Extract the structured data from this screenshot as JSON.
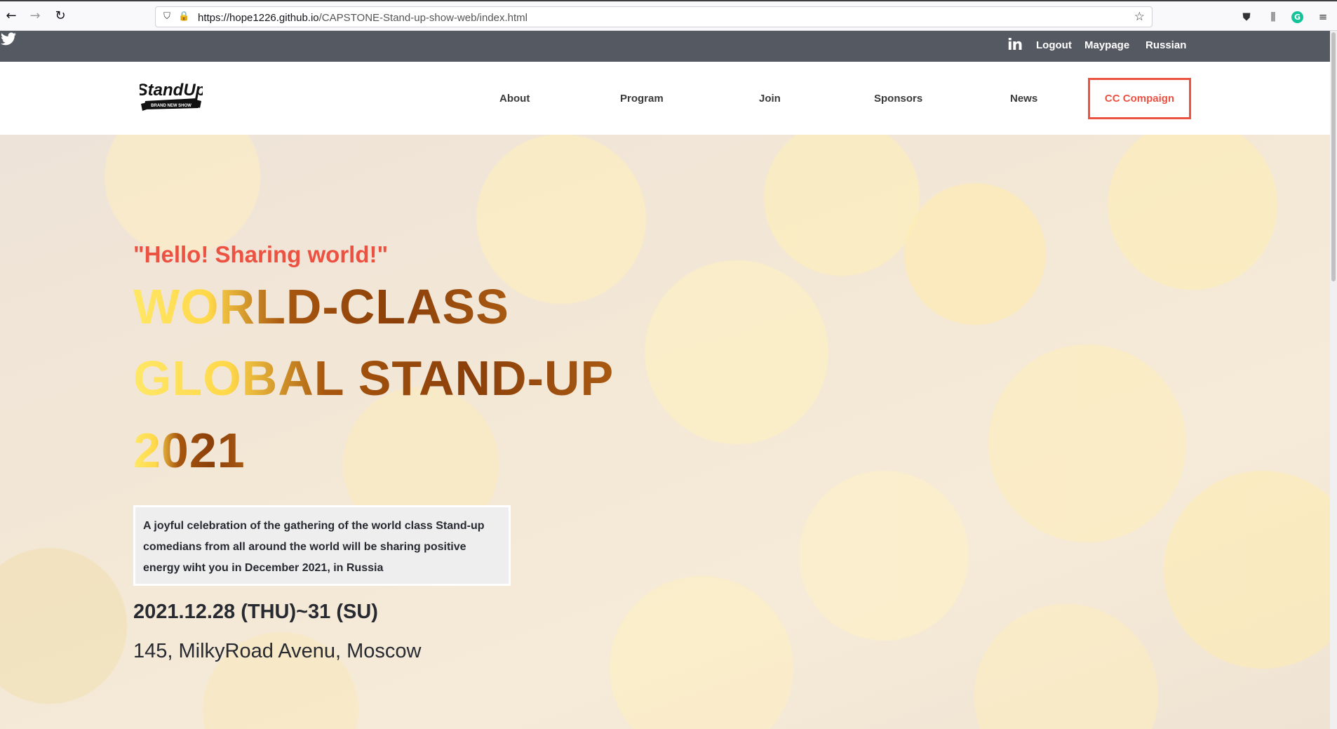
{
  "browser": {
    "url_host": "https://hope1226.github.io",
    "url_path": "/CAPSTONE-Stand-up-show-web/index.html"
  },
  "topbar": {
    "icons": [
      "twitter-icon",
      "linkedin-icon"
    ],
    "linkedin_glyph": "in",
    "links": [
      "Logout",
      "Maypage",
      "Russian"
    ]
  },
  "header": {
    "logo_text": "StandUp",
    "logo_subtext": "BRAND NEW SHOW",
    "menu": [
      "About",
      "Program",
      "Join",
      "Sponsors",
      "News"
    ],
    "cta": "CC Compaign",
    "accent_color": "#ec5242"
  },
  "hero": {
    "tagline": "\"Hello! Sharing world!\"",
    "headline_lines": [
      "WORLD-CLASS",
      "GLOBAL STAND-UP",
      "2021"
    ],
    "description": "A joyful celebration of the gathering of the world class Stand-up comedians from all around the world will be sharing positive energy wiht you in December 2021, in Russia",
    "date": "2021.12.28 (THU)~31 (SU)",
    "location": "145, MilkyRoad Avenu, Moscow"
  }
}
